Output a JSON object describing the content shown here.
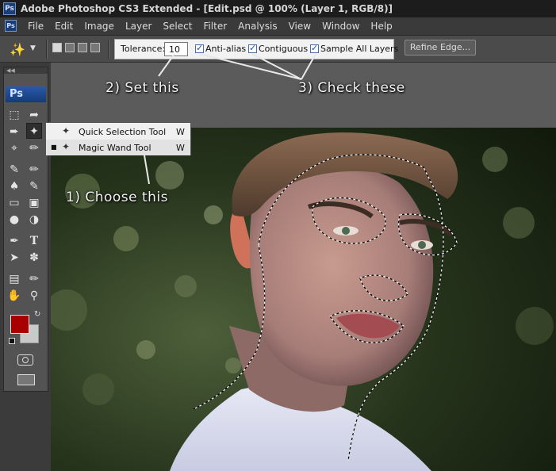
{
  "window": {
    "title": "Adobe Photoshop CS3 Extended - [Edit.psd @ 100% (Layer 1, RGB/8)]",
    "app_icon": "Ps"
  },
  "menu": {
    "icon": "Ps",
    "items": [
      "File",
      "Edit",
      "Image",
      "Layer",
      "Select",
      "Filter",
      "Analysis",
      "View",
      "Window",
      "Help"
    ]
  },
  "options_bar": {
    "tool_icon": "magic-wand-icon",
    "tolerance_label": "Tolerance:",
    "tolerance_value": "10",
    "anti_alias_label": "Anti-alias",
    "anti_alias_checked": true,
    "contiguous_label": "Contiguous",
    "contiguous_checked": true,
    "sample_all_layers_label": "Sample All Layers",
    "sample_all_layers_checked": true,
    "refine_edge_label": "Refine Edge..."
  },
  "toolbox": {
    "logo": "Ps",
    "foreground_color": "#a80000",
    "background_color": "#c9c9c9"
  },
  "flyout": {
    "items": [
      {
        "label": "Quick Selection Tool",
        "shortcut": "W",
        "icon": "quick-selection-icon",
        "active": false
      },
      {
        "label": "Magic Wand Tool",
        "shortcut": "W",
        "icon": "magic-wand-icon",
        "active": true
      }
    ]
  },
  "annotations": {
    "choose": "1) Choose this",
    "set": "2) Set this",
    "check": "3) Check these"
  }
}
